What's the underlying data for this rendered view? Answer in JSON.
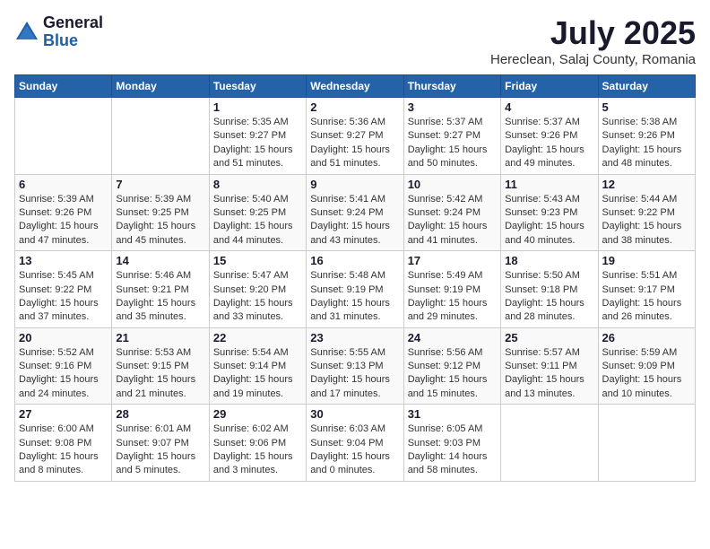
{
  "header": {
    "logo_general": "General",
    "logo_blue": "Blue",
    "month": "July 2025",
    "location": "Hereclean, Salaj County, Romania"
  },
  "weekdays": [
    "Sunday",
    "Monday",
    "Tuesday",
    "Wednesday",
    "Thursday",
    "Friday",
    "Saturday"
  ],
  "weeks": [
    [
      {
        "day": "",
        "info": ""
      },
      {
        "day": "",
        "info": ""
      },
      {
        "day": "1",
        "info": "Sunrise: 5:35 AM\nSunset: 9:27 PM\nDaylight: 15 hours\nand 51 minutes."
      },
      {
        "day": "2",
        "info": "Sunrise: 5:36 AM\nSunset: 9:27 PM\nDaylight: 15 hours\nand 51 minutes."
      },
      {
        "day": "3",
        "info": "Sunrise: 5:37 AM\nSunset: 9:27 PM\nDaylight: 15 hours\nand 50 minutes."
      },
      {
        "day": "4",
        "info": "Sunrise: 5:37 AM\nSunset: 9:26 PM\nDaylight: 15 hours\nand 49 minutes."
      },
      {
        "day": "5",
        "info": "Sunrise: 5:38 AM\nSunset: 9:26 PM\nDaylight: 15 hours\nand 48 minutes."
      }
    ],
    [
      {
        "day": "6",
        "info": "Sunrise: 5:39 AM\nSunset: 9:26 PM\nDaylight: 15 hours\nand 47 minutes."
      },
      {
        "day": "7",
        "info": "Sunrise: 5:39 AM\nSunset: 9:25 PM\nDaylight: 15 hours\nand 45 minutes."
      },
      {
        "day": "8",
        "info": "Sunrise: 5:40 AM\nSunset: 9:25 PM\nDaylight: 15 hours\nand 44 minutes."
      },
      {
        "day": "9",
        "info": "Sunrise: 5:41 AM\nSunset: 9:24 PM\nDaylight: 15 hours\nand 43 minutes."
      },
      {
        "day": "10",
        "info": "Sunrise: 5:42 AM\nSunset: 9:24 PM\nDaylight: 15 hours\nand 41 minutes."
      },
      {
        "day": "11",
        "info": "Sunrise: 5:43 AM\nSunset: 9:23 PM\nDaylight: 15 hours\nand 40 minutes."
      },
      {
        "day": "12",
        "info": "Sunrise: 5:44 AM\nSunset: 9:22 PM\nDaylight: 15 hours\nand 38 minutes."
      }
    ],
    [
      {
        "day": "13",
        "info": "Sunrise: 5:45 AM\nSunset: 9:22 PM\nDaylight: 15 hours\nand 37 minutes."
      },
      {
        "day": "14",
        "info": "Sunrise: 5:46 AM\nSunset: 9:21 PM\nDaylight: 15 hours\nand 35 minutes."
      },
      {
        "day": "15",
        "info": "Sunrise: 5:47 AM\nSunset: 9:20 PM\nDaylight: 15 hours\nand 33 minutes."
      },
      {
        "day": "16",
        "info": "Sunrise: 5:48 AM\nSunset: 9:19 PM\nDaylight: 15 hours\nand 31 minutes."
      },
      {
        "day": "17",
        "info": "Sunrise: 5:49 AM\nSunset: 9:19 PM\nDaylight: 15 hours\nand 29 minutes."
      },
      {
        "day": "18",
        "info": "Sunrise: 5:50 AM\nSunset: 9:18 PM\nDaylight: 15 hours\nand 28 minutes."
      },
      {
        "day": "19",
        "info": "Sunrise: 5:51 AM\nSunset: 9:17 PM\nDaylight: 15 hours\nand 26 minutes."
      }
    ],
    [
      {
        "day": "20",
        "info": "Sunrise: 5:52 AM\nSunset: 9:16 PM\nDaylight: 15 hours\nand 24 minutes."
      },
      {
        "day": "21",
        "info": "Sunrise: 5:53 AM\nSunset: 9:15 PM\nDaylight: 15 hours\nand 21 minutes."
      },
      {
        "day": "22",
        "info": "Sunrise: 5:54 AM\nSunset: 9:14 PM\nDaylight: 15 hours\nand 19 minutes."
      },
      {
        "day": "23",
        "info": "Sunrise: 5:55 AM\nSunset: 9:13 PM\nDaylight: 15 hours\nand 17 minutes."
      },
      {
        "day": "24",
        "info": "Sunrise: 5:56 AM\nSunset: 9:12 PM\nDaylight: 15 hours\nand 15 minutes."
      },
      {
        "day": "25",
        "info": "Sunrise: 5:57 AM\nSunset: 9:11 PM\nDaylight: 15 hours\nand 13 minutes."
      },
      {
        "day": "26",
        "info": "Sunrise: 5:59 AM\nSunset: 9:09 PM\nDaylight: 15 hours\nand 10 minutes."
      }
    ],
    [
      {
        "day": "27",
        "info": "Sunrise: 6:00 AM\nSunset: 9:08 PM\nDaylight: 15 hours\nand 8 minutes."
      },
      {
        "day": "28",
        "info": "Sunrise: 6:01 AM\nSunset: 9:07 PM\nDaylight: 15 hours\nand 5 minutes."
      },
      {
        "day": "29",
        "info": "Sunrise: 6:02 AM\nSunset: 9:06 PM\nDaylight: 15 hours\nand 3 minutes."
      },
      {
        "day": "30",
        "info": "Sunrise: 6:03 AM\nSunset: 9:04 PM\nDaylight: 15 hours\nand 0 minutes."
      },
      {
        "day": "31",
        "info": "Sunrise: 6:05 AM\nSunset: 9:03 PM\nDaylight: 14 hours\nand 58 minutes."
      },
      {
        "day": "",
        "info": ""
      },
      {
        "day": "",
        "info": ""
      }
    ]
  ]
}
